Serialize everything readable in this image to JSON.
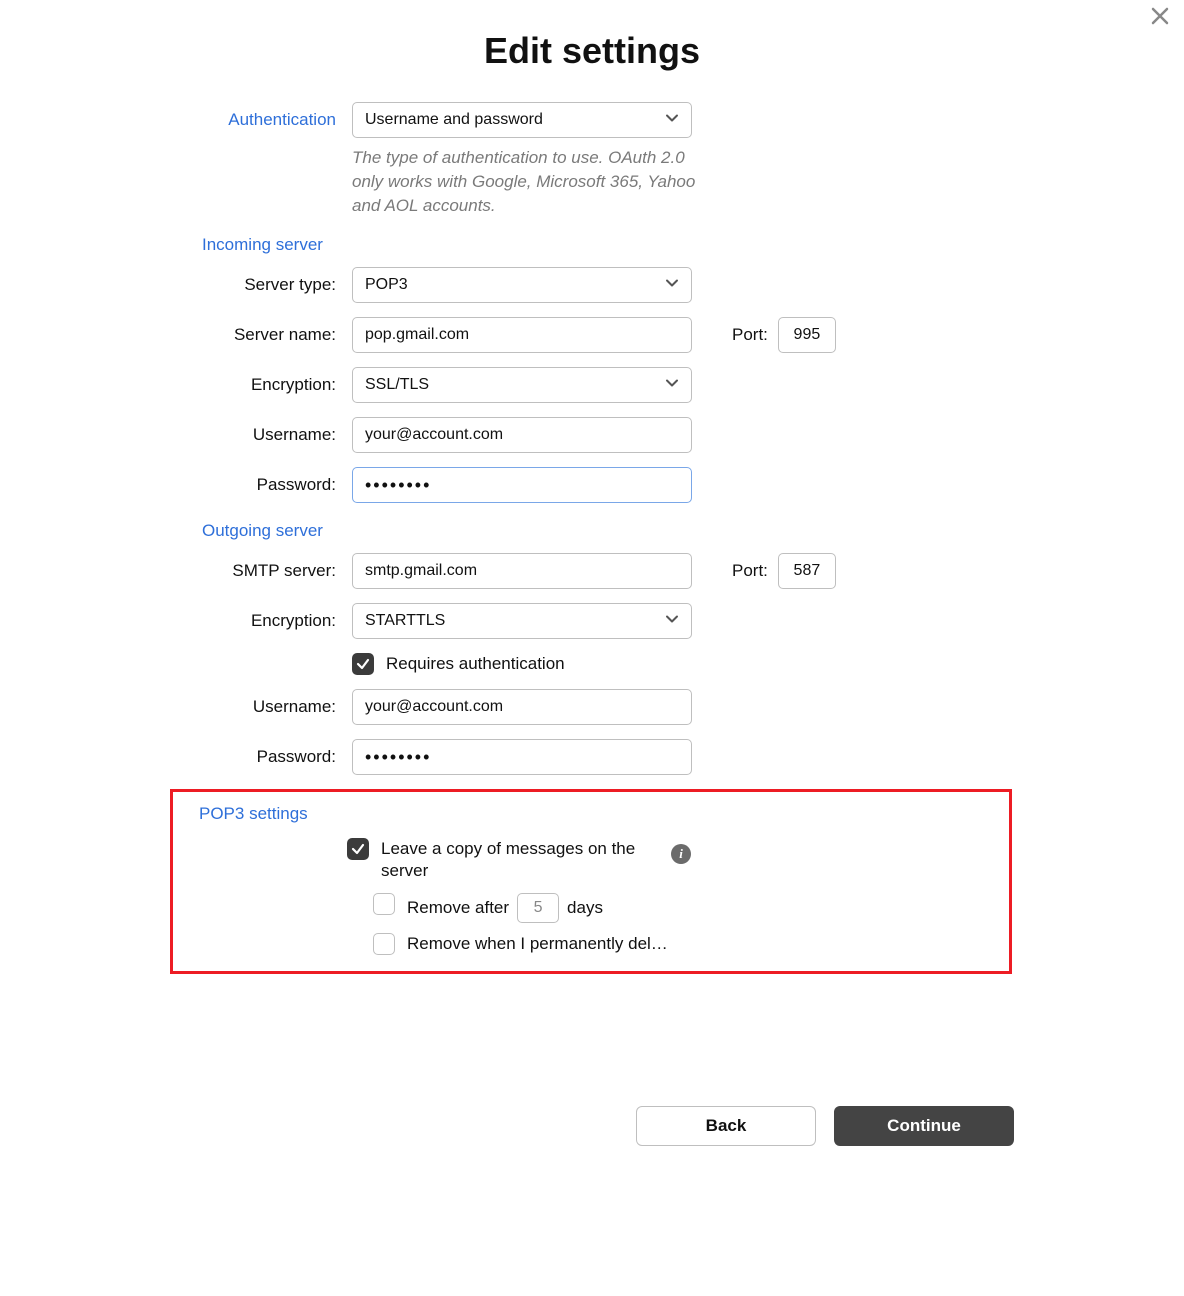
{
  "close_icon": "close-icon",
  "title": "Edit settings",
  "auth": {
    "label": "Authentication",
    "value": "Username and password",
    "helper": "The type of authentication to use. OAuth 2.0 only works with Google, Microsoft 365, Yahoo and AOL accounts."
  },
  "incoming": {
    "section": "Incoming server",
    "server_type_label": "Server type:",
    "server_type_value": "POP3",
    "server_name_label": "Server name:",
    "server_name_value": "pop.gmail.com",
    "port_label": "Port:",
    "port_value": "995",
    "encryption_label": "Encryption:",
    "encryption_value": "SSL/TLS",
    "username_label": "Username:",
    "username_value": "your@account.com",
    "password_label": "Password:",
    "password_value": "••••••••"
  },
  "outgoing": {
    "section": "Outgoing server",
    "smtp_label": "SMTP server:",
    "smtp_value": "smtp.gmail.com",
    "port_label": "Port:",
    "port_value": "587",
    "encryption_label": "Encryption:",
    "encryption_value": "STARTTLS",
    "requires_auth_label": "Requires authentication",
    "requires_auth_checked": true,
    "username_label": "Username:",
    "username_value": "your@account.com",
    "password_label": "Password:",
    "password_value": "••••••••"
  },
  "pop3": {
    "section": "POP3 settings",
    "leave_copy_label": "Leave a copy of messages on the server",
    "leave_copy_checked": true,
    "remove_after_prefix": "Remove after",
    "remove_after_days": "5",
    "remove_after_suffix": "days",
    "remove_after_checked": false,
    "remove_permanent_label": "Remove when I permanently del…",
    "remove_permanent_checked": false
  },
  "buttons": {
    "back": "Back",
    "continue": "Continue"
  }
}
